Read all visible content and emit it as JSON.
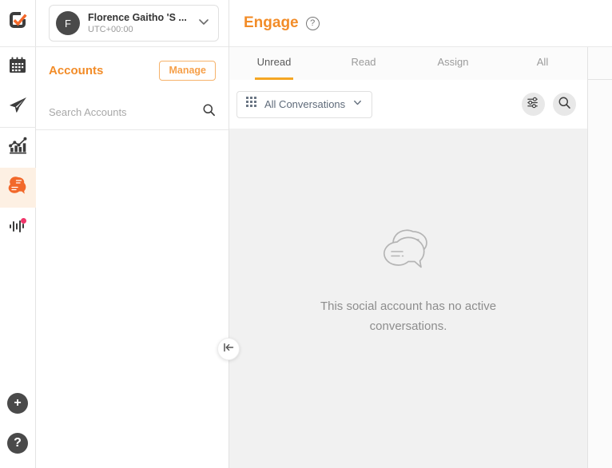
{
  "brand": {
    "accent": "#f28c28",
    "tab_underline": "#f5a623",
    "rail_active_bg": "#fdf0e3",
    "badge": "#f0356a"
  },
  "rail": {
    "logo": {
      "name": "app-logo"
    },
    "items": [
      {
        "icon": "calendar-icon",
        "label": "Publish Calendar"
      },
      {
        "icon": "paper-plane-icon",
        "label": "Send"
      },
      {
        "icon": "analytics-bar-chart-icon",
        "label": "Analytics"
      },
      {
        "icon": "chat-bubbles-icon",
        "label": "Engage",
        "active": true
      },
      {
        "icon": "listening-waveform-icon",
        "label": "Listening",
        "badge": true
      }
    ],
    "bottom": [
      {
        "icon": "plus-icon",
        "label": "+"
      },
      {
        "icon": "question-mark-icon",
        "label": "?"
      }
    ]
  },
  "account_switcher": {
    "avatar_initial": "F",
    "name": "Florence Gaitho 'S ...",
    "timezone": "UTC+00:00",
    "chevron": "chevron-down-icon"
  },
  "accounts_panel": {
    "title": "Accounts",
    "manage_label": "Manage",
    "search_placeholder": "Search Accounts",
    "search_value": "",
    "search_icon": "search-icon",
    "collapse_icon": "collapse-left-icon"
  },
  "main": {
    "title": "Engage",
    "help_icon": "help-circle-icon",
    "help_glyph": "?",
    "tabs": [
      {
        "label": "Unread",
        "active": true
      },
      {
        "label": "Read",
        "active": false
      },
      {
        "label": "Assign",
        "active": false
      },
      {
        "label": "All",
        "active": false
      }
    ],
    "filter_bar": {
      "conversation_filter_label": "All Conversations",
      "grid_icon": "grid-apps-icon",
      "chevron": "chevron-down-icon",
      "settings_icon": "filter-sliders-icon",
      "search_icon": "search-icon"
    },
    "empty_state": {
      "icon": "chat-bubbles-outline-icon",
      "line1": "This social account has no",
      "line2": "active conversations."
    }
  }
}
